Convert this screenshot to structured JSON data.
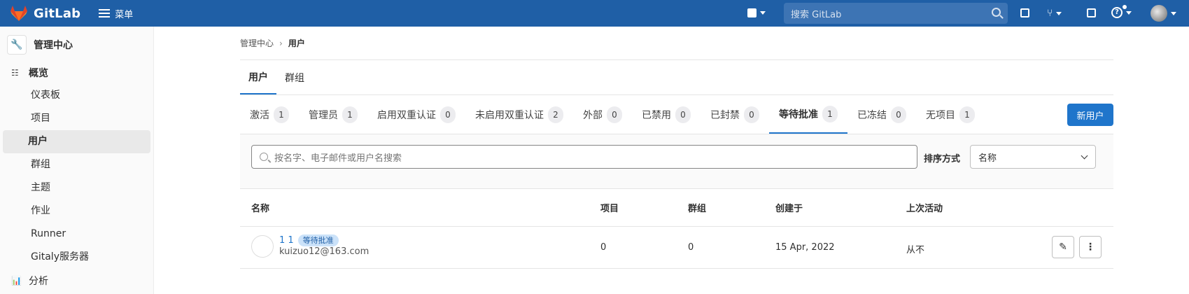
{
  "topbar": {
    "brand": "GitLab",
    "menu_label": "菜单",
    "search_placeholder": "搜索 GitLab"
  },
  "sidebar": {
    "title": "管理中心",
    "overview_label": "概览",
    "items": [
      "仪表板",
      "项目",
      "用户",
      "群组",
      "主题",
      "作业",
      "Runner",
      "Gitaly服务器"
    ],
    "analytics_label": "分析"
  },
  "breadcrumb": {
    "root": "管理中心",
    "current": "用户"
  },
  "tabs": [
    "用户",
    "群组"
  ],
  "filter_tabs": [
    {
      "label": "激活",
      "count": "1"
    },
    {
      "label": "管理员",
      "count": "1"
    },
    {
      "label": "启用双重认证",
      "count": "0"
    },
    {
      "label": "未启用双重认证",
      "count": "2"
    },
    {
      "label": "外部",
      "count": "0"
    },
    {
      "label": "已禁用",
      "count": "0"
    },
    {
      "label": "已封禁",
      "count": "0"
    },
    {
      "label": "等待批准",
      "count": "1"
    },
    {
      "label": "已冻结",
      "count": "0"
    },
    {
      "label": "无项目",
      "count": "1"
    }
  ],
  "new_user_button": "新用户",
  "filter": {
    "search_placeholder": "按名字、电子邮件或用户名搜索",
    "sort_label": "排序方式",
    "sort_value": "名称"
  },
  "table": {
    "headers": [
      "名称",
      "项目",
      "群组",
      "创建于",
      "上次活动"
    ],
    "rows": [
      {
        "name": "1 1",
        "badge": "等待批准",
        "email": "kuizuo12@163.com",
        "projects": "0",
        "groups": "0",
        "created": "15 Apr, 2022",
        "last_activity": "从不"
      }
    ]
  },
  "colors": {
    "topbar": "#1f5fa6",
    "accent": "#1f75cb",
    "logo": "#e24329"
  }
}
